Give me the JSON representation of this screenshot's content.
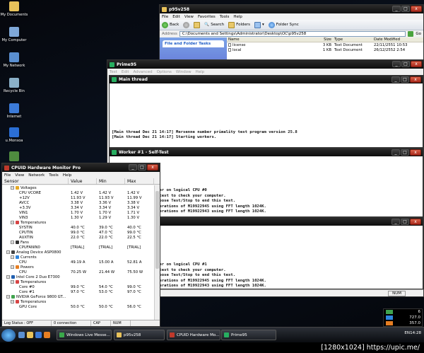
{
  "desktop_icons": [
    {
      "label": "My Documents",
      "color": "#e8c25a"
    },
    {
      "label": "My Computer",
      "color": "#7fa8d8"
    },
    {
      "label": "My Network",
      "color": "#5a8fd0"
    },
    {
      "label": "Recycle Bin",
      "color": "#8ab0c8"
    },
    {
      "label": "Internet",
      "color": "#3b7ad8"
    },
    {
      "label": "u.Monsoa",
      "color": "#2b6fd6"
    },
    {
      "label": "Control",
      "color": "#4f8b3f"
    }
  ],
  "explorer": {
    "title": "p95v258",
    "menu": [
      "File",
      "Edit",
      "View",
      "Favorites",
      "Tools",
      "Help"
    ],
    "toolbar": {
      "back": "Back",
      "search": "Search",
      "folders": "Folders",
      "folder_sync": "Folder Sync"
    },
    "address_label": "Address",
    "address_value": "C:\\Documents and Settings\\Administrator\\Desktop\\OC\\p95v258",
    "go": "Go",
    "task_pane_header": "File and Folder Tasks",
    "columns": [
      "Name",
      "Size",
      "Type",
      "Date Modified"
    ],
    "files": [
      {
        "name": "license",
        "size": "3 KB",
        "type": "Text Document",
        "date": "22/11/2551 10:53"
      },
      {
        "name": "local",
        "size": "1 KB",
        "type": "Text Document",
        "date": "26/12/2552 2:54"
      }
    ]
  },
  "prime": {
    "title": "Prime95",
    "menu": [
      "Test",
      "Edit",
      "Advanced",
      "Options",
      "Window",
      "Help"
    ],
    "main_thread": {
      "title": "Main thread",
      "lines": [
        "[Main thread Dec 21 14:17] Mersenne number primality test program version 25.8",
        "[Main thread Dec 21 14:17] Starting workers."
      ]
    },
    "worker1": {
      "title": "Worker #1 - Self-Test",
      "lines": [
        "tarting",
        "affinity to run worker on logical CPU #0",
        "g a continuous self-test to check your computer.",
        "read stress.txt.  Choose Test/Stop to end this test.",
        "4000 Lucas-Lehmer iterations of M19922945 using FFT length 1024K.",
        "4000 Lucas-Lehmer iterations of M19922943 using FFT length 1024K."
      ]
    },
    "worker2": {
      "lines": [
        "tarting",
        "affinity to run worker on logical CPU #1",
        "g a continuous self-test to check your computer.",
        "read stress.txt.  Choose Test/Stop to end this test.",
        "4000 Lucas-Lehmer iterations of M19922945 using FFT length 1024K.",
        "4000 Lucas-Lehmer iterations of M19922943 using FFT length 1024K."
      ]
    },
    "status_num": "NUM"
  },
  "hwmon": {
    "title": "CPUID Hardware Monitor Pro",
    "menu": [
      "File",
      "View",
      "Network",
      "Tools",
      "Help"
    ],
    "columns": [
      "Sensor",
      "Value",
      "Min",
      "Max"
    ],
    "rows": [
      {
        "indent": 2,
        "kind": "group",
        "icon": "voltage",
        "name": "Voltages",
        "v": "",
        "mn": "",
        "mx": ""
      },
      {
        "indent": 4,
        "kind": "leaf",
        "name": "CPU VCORE",
        "v": "1.42 V",
        "mn": "1.42 V",
        "mx": "1.42 V"
      },
      {
        "indent": 4,
        "kind": "leaf",
        "name": "+12V",
        "v": "11.93 V",
        "mn": "11.93 V",
        "mx": "11.99 V"
      },
      {
        "indent": 4,
        "kind": "leaf",
        "name": "AVCC",
        "v": "3.38 V",
        "mn": "3.36 V",
        "mx": "3.38 V"
      },
      {
        "indent": 4,
        "kind": "leaf",
        "name": "+3.3V",
        "v": "3.34 V",
        "mn": "3.34 V",
        "mx": "3.34 V"
      },
      {
        "indent": 4,
        "kind": "leaf",
        "name": "VIN1",
        "v": "1.70 V",
        "mn": "1.70 V",
        "mx": "1.71 V"
      },
      {
        "indent": 4,
        "kind": "leaf",
        "name": "VIN3",
        "v": "1.30 V",
        "mn": "1.29 V",
        "mx": "1.30 V"
      },
      {
        "indent": 2,
        "kind": "group",
        "icon": "temp",
        "name": "Temperatures",
        "v": "",
        "mn": "",
        "mx": ""
      },
      {
        "indent": 4,
        "kind": "leaf",
        "name": "SYSTIN",
        "v": "40.0 °C",
        "mn": "39.0 °C",
        "mx": "40.0 °C"
      },
      {
        "indent": 4,
        "kind": "leaf",
        "name": "CPUTIN",
        "v": "99.0 °C",
        "mn": "47.0 °C",
        "mx": "99.0 °C"
      },
      {
        "indent": 4,
        "kind": "leaf",
        "name": "AUXTIN",
        "v": "22.0 °C",
        "mn": "22.0 °C",
        "mx": "22.5 °C"
      },
      {
        "indent": 2,
        "kind": "group",
        "icon": "fan",
        "name": "Fans",
        "v": "",
        "mn": "",
        "mx": ""
      },
      {
        "indent": 4,
        "kind": "leaf",
        "name": "CPUFANIN0",
        "v": "[TRIAL]",
        "mn": "[TRIAL]",
        "mx": "[TRIAL]"
      },
      {
        "indent": 1,
        "kind": "device",
        "icon": "chip",
        "name": "Analog Device ASP0800",
        "v": "",
        "mn": "",
        "mx": ""
      },
      {
        "indent": 2,
        "kind": "group",
        "icon": "current",
        "name": "Currents",
        "v": "",
        "mn": "",
        "mx": ""
      },
      {
        "indent": 4,
        "kind": "leaf",
        "name": "CPU",
        "v": "49.19 A",
        "mn": "15.00 A",
        "mx": "52.81 A"
      },
      {
        "indent": 2,
        "kind": "group",
        "icon": "power",
        "name": "Powers",
        "v": "",
        "mn": "",
        "mx": ""
      },
      {
        "indent": 4,
        "kind": "leaf",
        "name": "CPU",
        "v": "70.25 W",
        "mn": "21.44 W",
        "mx": "75.50 W"
      },
      {
        "indent": 1,
        "kind": "device",
        "icon": "cpu",
        "name": "Intel Core 2 Duo E7300",
        "v": "",
        "mn": "",
        "mx": ""
      },
      {
        "indent": 2,
        "kind": "group",
        "icon": "temp",
        "name": "Temperatures",
        "v": "",
        "mn": "",
        "mx": ""
      },
      {
        "indent": 4,
        "kind": "leaf",
        "name": "Core #0",
        "v": "99.0 °C",
        "mn": "54.0 °C",
        "mx": "99.0 °C"
      },
      {
        "indent": 4,
        "kind": "leaf",
        "name": "Core #1",
        "v": "97.0 °C",
        "mn": "53.0 °C",
        "mx": "97.0 °C"
      },
      {
        "indent": 1,
        "kind": "device",
        "icon": "gpu",
        "name": "NVIDIA GeForce 9800 GT...",
        "v": "",
        "mn": "",
        "mx": ""
      },
      {
        "indent": 2,
        "kind": "group",
        "icon": "temp",
        "name": "Temperatures",
        "v": "",
        "mn": "",
        "mx": ""
      },
      {
        "indent": 4,
        "kind": "leaf",
        "name": "GPU Core",
        "v": "50.0 °C",
        "mn": "50.0 °C",
        "mx": "56.0 °C"
      }
    ],
    "status": [
      "Log Status : OFF",
      "0 connection",
      "CAP",
      "NUM"
    ]
  },
  "taskbar": {
    "buttons": [
      {
        "label": "Windows Live Messe...",
        "color": "#3aa84a"
      },
      {
        "label": "p95v258",
        "color": "#e8c25a"
      },
      {
        "label": "CPUID Hardware Mo...",
        "color": "#c0392b"
      },
      {
        "label": "Prime95",
        "color": "#27ae60"
      }
    ],
    "tray": "EN",
    "clock": "14:28"
  },
  "gadget": {
    "values": [
      "6",
      "727.0",
      "357.0"
    ]
  },
  "watermark": "[1280x1024] https://upic.me/"
}
